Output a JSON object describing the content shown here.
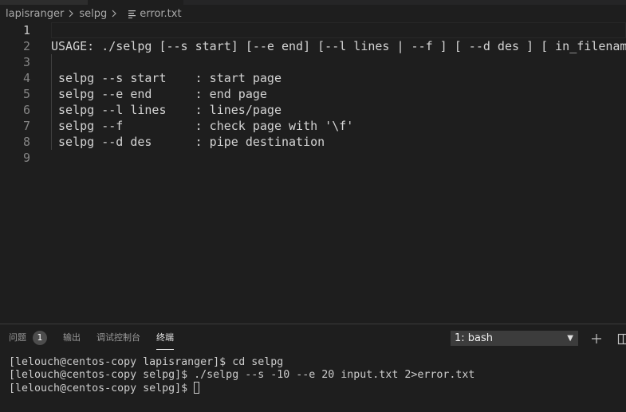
{
  "breadcrumb": {
    "items": [
      "lapisranger",
      "selpg"
    ],
    "file": "error.txt"
  },
  "editor": {
    "line_numbers": [
      "1",
      "2",
      "3",
      "4",
      "5",
      "6",
      "7",
      "8",
      "9"
    ],
    "active_line": "1",
    "lines": [
      "",
      "USAGE: ./selpg [--s start] [--e end] [--l lines | --f ] [ --d des ] [ in_filename ]",
      "",
      " selpg --s start    : start page",
      " selpg --e end      : end page",
      " selpg --l lines    : lines/page",
      " selpg --f          : check page with '\\f'",
      " selpg --d des      : pipe destination",
      ""
    ]
  },
  "panel": {
    "tabs": [
      {
        "label": "问题",
        "badge": "1"
      },
      {
        "label": "输出"
      },
      {
        "label": "调试控制台"
      },
      {
        "label": "终端",
        "active": true
      }
    ],
    "terminal_select": "1: bash",
    "icons": [
      "plus-icon",
      "split-icon"
    ]
  },
  "terminal": {
    "lines": [
      "[lelouch@centos-copy lapisranger]$ cd selpg",
      "[lelouch@centos-copy selpg]$ ./selpg --s -10 --e 20 input.txt 2>error.txt",
      "[lelouch@centos-copy selpg]$ "
    ]
  },
  "colors": {
    "background": "#1e1e1e",
    "text": "#d4d4d4",
    "gutter": "#858585"
  }
}
